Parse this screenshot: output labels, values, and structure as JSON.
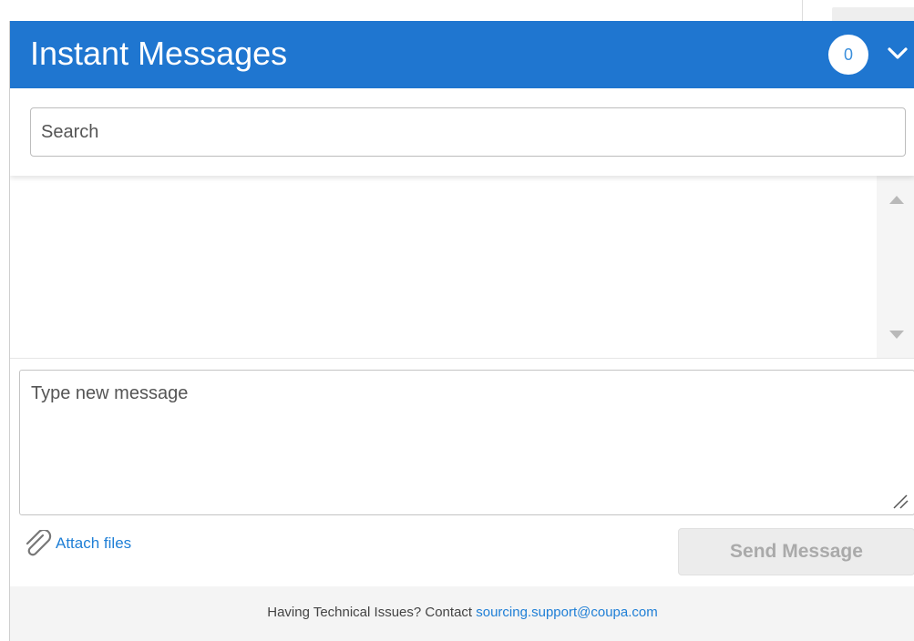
{
  "panel": {
    "title": "Instant Messages",
    "unread_count": "0",
    "collapse_icon": "chevron-down-icon"
  },
  "search": {
    "placeholder": "Search"
  },
  "messages": {
    "items": [],
    "scroll_up_icon": "triangle-up-icon",
    "scroll_down_icon": "triangle-down-icon"
  },
  "compose": {
    "placeholder": "Type new message",
    "attach_label": "Attach files",
    "attach_icon": "paperclip-icon",
    "send_label": "Send Message"
  },
  "footer": {
    "text": "Having Technical Issues? Contact",
    "link_text": "sourcing.support@coupa.com"
  },
  "colors": {
    "header_bg": "#1f76d0",
    "link": "#1f7fd6",
    "badge_text": "#3b8fdc",
    "send_disabled_bg": "#ececec",
    "footer_bg": "#f4f4f4"
  }
}
